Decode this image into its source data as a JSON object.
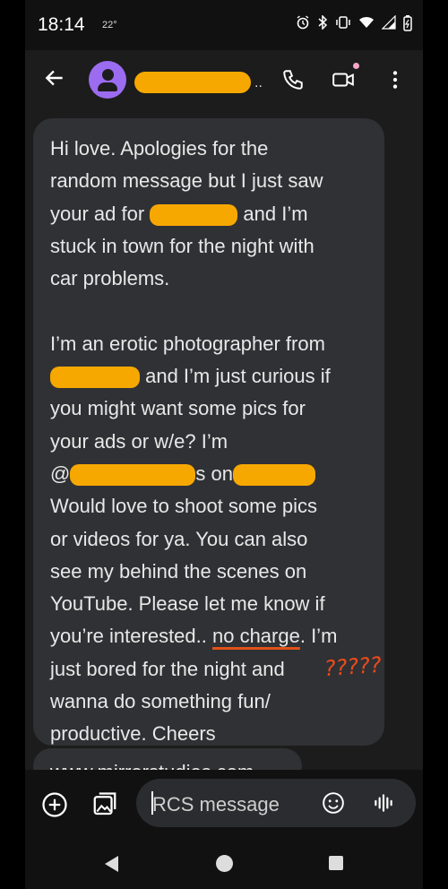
{
  "status_bar": {
    "time": "18:14",
    "temperature": "22°",
    "icons": [
      "alarm-icon",
      "bluetooth-icon",
      "vibrate-icon",
      "wifi-icon",
      "signal-icon",
      "battery-icon"
    ]
  },
  "app_bar": {
    "back_icon": "arrow-left-icon",
    "contact_name_suffix": "..",
    "actions": [
      "phone-icon",
      "video-call-icon",
      "more-vert-icon"
    ]
  },
  "message": {
    "lines": [
      {
        "type": "text",
        "text": "Hi love. Apologies for the"
      },
      {
        "type": "text",
        "text": "random message but I just saw"
      },
      {
        "type": "redacted",
        "before": "your ad for ",
        "after": " and I’m"
      },
      {
        "type": "text",
        "text": "stuck in town for the night with"
      },
      {
        "type": "text",
        "text": "car problems."
      },
      {
        "type": "blank",
        "text": ""
      },
      {
        "type": "text",
        "text": "I’m an erotic photographer from"
      },
      {
        "type": "redacted",
        "before": "",
        "after": " and I’m just curious if"
      },
      {
        "type": "text",
        "text": "you might want some pics for"
      },
      {
        "type": "text",
        "text": "your ads or w/e? I’m"
      },
      {
        "type": "double-redacted",
        "before": "@",
        "middle": "s on",
        "after": ""
      },
      {
        "type": "text",
        "text": "Would love to shoot some pics"
      },
      {
        "type": "text",
        "text": "or videos for ya. You can also"
      },
      {
        "type": "text",
        "text": "see my behind the scenes on"
      },
      {
        "type": "text",
        "text": "YouTube. Please let me know if"
      },
      {
        "type": "underline",
        "before": "you’re interested.. ",
        "underlined": "no charge",
        "after": ". I’m"
      },
      {
        "type": "text",
        "text": "just bored for the night and"
      },
      {
        "type": "text",
        "text": "wanna do something fun/"
      },
      {
        "type": "text",
        "text": "productive. Cheers"
      }
    ],
    "annotation": "?????"
  },
  "next_message": {
    "partial_text": "www.mirrorstudios.com"
  },
  "input_bar": {
    "placeholder": "RCS message",
    "icons": [
      "add-circle-icon",
      "gallery-icon",
      "emoji-icon",
      "voice-icon"
    ]
  },
  "colors": {
    "redaction": "#f7a800",
    "highlight_pink": "#f4a6c7",
    "annotation": "#e94b1c",
    "avatar": "#9b6cf0"
  }
}
